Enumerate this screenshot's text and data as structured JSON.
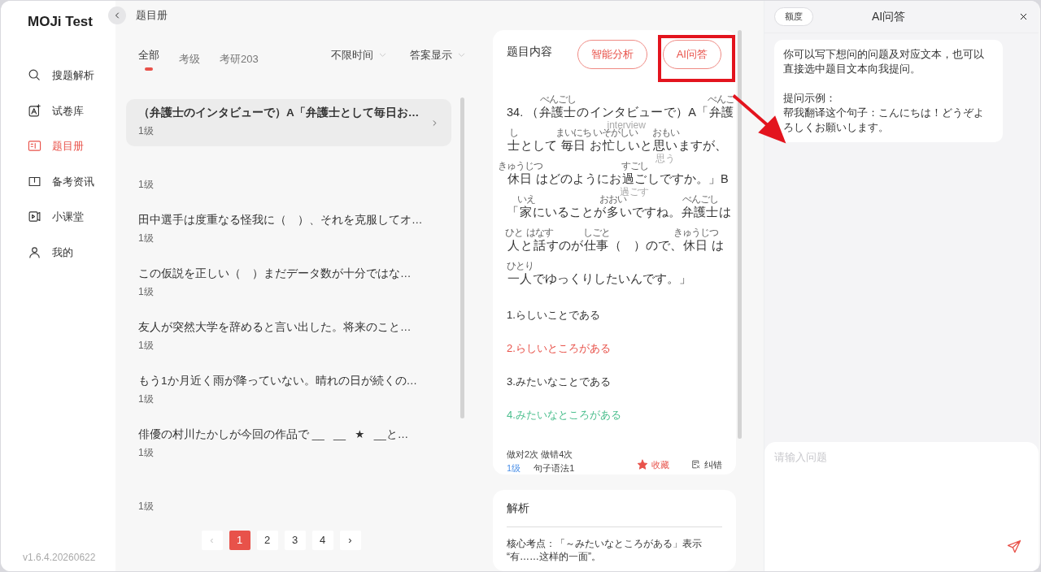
{
  "app": {
    "logo": "MOJi Test",
    "version": "v1.6.4.20260622"
  },
  "sidebar": {
    "items": [
      {
        "label": "搜题解析",
        "selected": false
      },
      {
        "label": "试卷库",
        "selected": false
      },
      {
        "label": "题目册",
        "selected": true
      },
      {
        "label": "备考资讯",
        "selected": false
      },
      {
        "label": "小课堂",
        "selected": false
      },
      {
        "label": "我的",
        "selected": false
      }
    ]
  },
  "breadcrumb": "题目册",
  "tabs": [
    {
      "label": "全部",
      "selected": true
    },
    {
      "label": "考级",
      "selected": false
    },
    {
      "label": "考研203",
      "selected": false
    }
  ],
  "filters": [
    {
      "label": "不限时间"
    },
    {
      "label": "答案显示"
    }
  ],
  "questions": [
    {
      "title": "（弁護士のインタビューで）A「弁護士として毎日お…",
      "grade": "1级",
      "selected": true
    },
    {
      "grade": "1级",
      "selected": false
    },
    {
      "title": "田中選手は度重なる怪我に（　）、それを克服してオ…",
      "grade": "1级",
      "selected": false
    },
    {
      "title": "この仮説を正しい（　）まだデータ数が十分ではな…",
      "grade": "1级",
      "selected": false
    },
    {
      "title": "友人が突然大学を辞めると言い出した。将来のこと…",
      "grade": "1级",
      "selected": false
    },
    {
      "title": "もう1か月近く雨が降っていない。晴れの日が続くの…",
      "grade": "1级",
      "selected": false
    },
    {
      "title": "俳優の村川たかしが今回の作品で __   __   ★   __と…",
      "grade": "1级",
      "selected": false
    },
    {
      "grade": "1级",
      "selected": false
    }
  ],
  "pagination": {
    "prev": {
      "label": "‹",
      "disabled": true
    },
    "pages": [
      {
        "label": "1",
        "selected": true
      },
      {
        "label": "2",
        "selected": false
      },
      {
        "label": "3",
        "selected": false
      },
      {
        "label": "4",
        "selected": false
      }
    ],
    "next": {
      "label": "›",
      "disabled": false
    }
  },
  "question_card": {
    "title": "题目内容",
    "buttons": [
      "智能分析",
      "AI问答"
    ],
    "lines": [
      [
        {
          "text": "34. （"
        },
        {
          "text": "弁護士",
          "ruby": "べんごし"
        },
        {
          "text": "の"
        },
        {
          "text": "インタビュー",
          "gloss": "interview"
        },
        {
          "text": "で）A「"
        },
        {
          "text": "弁護",
          "ruby": "べんご"
        }
      ],
      [
        {
          "text": "士",
          "ruby": "し"
        },
        {
          "text": "として "
        },
        {
          "text": "毎日",
          "ruby": "まいにち"
        },
        {
          "text": " お"
        },
        {
          "text": "忙し",
          "ruby": "いそがしい"
        },
        {
          "text": "いと"
        },
        {
          "text": "思い",
          "ruby": "おもい",
          "gloss": "思う"
        },
        {
          "text": "ますが、"
        }
      ],
      [
        {
          "text": "休日",
          "ruby": "きゅうじつ"
        },
        {
          "text": " はどのようにお"
        },
        {
          "text": "過ご",
          "ruby": "すごし",
          "gloss": "過ごす"
        },
        {
          "text": "しですか。」B"
        }
      ],
      [
        {
          "text": "「"
        },
        {
          "text": "家",
          "ruby": "いえ"
        },
        {
          "text": "にいることが"
        },
        {
          "text": "多",
          "ruby": "おおい"
        },
        {
          "text": "いですね。"
        },
        {
          "text": "弁護士",
          "ruby": "べんごし"
        },
        {
          "text": "は"
        }
      ],
      [
        {
          "text": "人",
          "ruby": "ひと"
        },
        {
          "text": "と"
        },
        {
          "text": "話",
          "ruby": "はなす"
        },
        {
          "text": "すのが"
        },
        {
          "text": "仕事",
          "ruby": "しごと"
        },
        {
          "text": "（　）ので、"
        },
        {
          "text": "休日",
          "ruby": "きゅうじつ"
        },
        {
          "text": " は"
        }
      ],
      [
        {
          "text": "一人",
          "ruby": "ひとり"
        },
        {
          "text": "でゆっくりしたいんです。」"
        }
      ]
    ],
    "options": [
      {
        "text": "1.らしいことである",
        "wrong": false,
        "correct": false
      },
      {
        "text": "2.らしいところがある",
        "wrong": true,
        "correct": false
      },
      {
        "text": "3.みたいなことである",
        "wrong": false,
        "correct": false
      },
      {
        "text": "4.みたいなところがある",
        "wrong": false,
        "correct": true
      }
    ],
    "stats": "做对2次 做错4次",
    "grade": "1级",
    "tag": "句子语法1",
    "actions": [
      {
        "label": "收藏",
        "active": true
      },
      {
        "label": "纠错",
        "active": false
      }
    ]
  },
  "analysis": {
    "title": "解析",
    "lines": [
      "核心考点：「～みたいなところがある」表示",
      "“有……这样的一面”。"
    ]
  },
  "ai_panel": {
    "quota_button": "额度",
    "title": "AI问答",
    "message": [
      "你可以写下想问的问题及对应文本，也可以直接选中题目文本向我提问。",
      "提问示例：",
      "帮我翻译这个句子：こんにちは！どうぞよろしくお願いします。"
    ],
    "input_placeholder": "请输入问题"
  },
  "annotation": {
    "highlight_box": true,
    "arrow": true
  }
}
